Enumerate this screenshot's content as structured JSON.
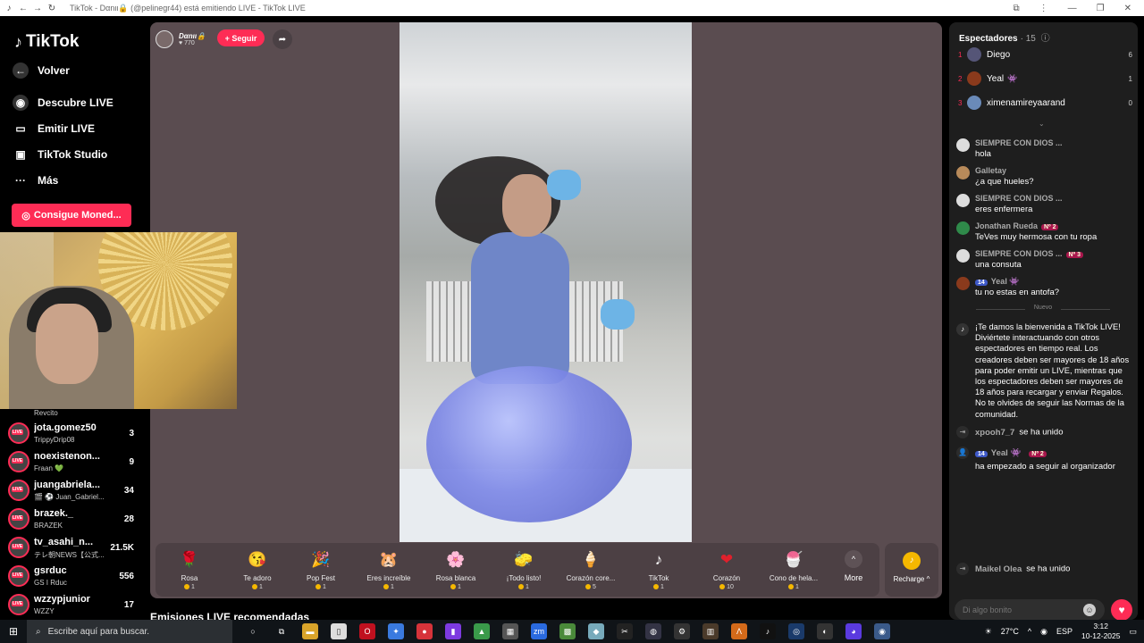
{
  "browser": {
    "tab_title": "TikTok - Dαnιι🔒 (@pelinegr44) está emitiendo LIVE - TikTok LIVE"
  },
  "sidebar": {
    "logo": "TikTok",
    "back": "Volver",
    "nav": [
      {
        "label": "Descubre LIVE",
        "icon": "discover-icon"
      },
      {
        "label": "Emitir LIVE",
        "icon": "camera-icon"
      },
      {
        "label": "TikTok Studio",
        "icon": "studio-icon"
      },
      {
        "label": "Más",
        "icon": "more-icon"
      }
    ],
    "coins_button": "Consigue Moned...",
    "partial_sub": "Revcito",
    "streams": [
      {
        "name": "jota.gomez50",
        "sub": "TrippyDrip08",
        "count": "3"
      },
      {
        "name": "noexistenon...",
        "sub": "Fraan 💚",
        "count": "9"
      },
      {
        "name": "juangabriela...",
        "sub": "🎬 ⚽ Juan_Gabriel...",
        "count": "34"
      },
      {
        "name": "brazek._",
        "sub": "BRAZEK",
        "count": "28"
      },
      {
        "name": "tv_asahi_n...",
        "sub": "テレ朝NEWS【公式...",
        "count": "21.5K"
      },
      {
        "name": "gsrduc",
        "sub": "GS I Rduc",
        "count": "556"
      },
      {
        "name": "wzzypjunior",
        "sub": "WZZY",
        "count": "17"
      }
    ]
  },
  "host": {
    "name": "Dαnιι🔒",
    "likes": "770",
    "follow_label": "+ Seguir"
  },
  "gifts": [
    {
      "icon": "🌹",
      "name": "Rosa",
      "price": "1"
    },
    {
      "icon": "😘",
      "name": "Te adoro",
      "price": "1"
    },
    {
      "icon": "🎉",
      "name": "Pop Fest",
      "price": "1"
    },
    {
      "icon": "🐹",
      "name": "Eres increíble",
      "price": "1"
    },
    {
      "icon": "🌸",
      "name": "Rosa blanca",
      "price": "1"
    },
    {
      "icon": "🧽",
      "name": "¡Todo listo!",
      "price": "1"
    },
    {
      "icon": "🍦",
      "name": "Corazón core...",
      "price": "5"
    },
    {
      "icon": "♪",
      "name": "TikTok",
      "price": "1"
    },
    {
      "icon": "❤",
      "name": "Corazón",
      "price": "10"
    },
    {
      "icon": "🍧",
      "name": "Cono de hela...",
      "price": "1"
    }
  ],
  "more_label": "More",
  "recharge_label": "Recharge ^",
  "recommended_title": "Emisiones LIVE recomendadas",
  "viewers": {
    "title": "Espectadores",
    "count": "· 15",
    "list": [
      {
        "rank": "1",
        "name": "Diego",
        "badge": "",
        "value": "6"
      },
      {
        "rank": "2",
        "name": "Yeal",
        "badge": "👾",
        "value": "1"
      },
      {
        "rank": "3",
        "name": "ximenamireyaarand",
        "badge": "",
        "value": "0"
      }
    ]
  },
  "chat": [
    {
      "name": "SIEMPRE CON DIOS ...",
      "text": "hola",
      "lvl": "",
      "badge": ""
    },
    {
      "name": "Galletay",
      "text": "¿a que hueles?",
      "lvl": "",
      "badge": ""
    },
    {
      "name": "SIEMPRE CON DIOS ...",
      "text": "eres enfermera",
      "lvl": "",
      "badge": ""
    },
    {
      "name": "Jonathan Rueda",
      "text": "TeVes muy hermosa con tu ropa",
      "lvl": "",
      "badge": "Nº 2"
    },
    {
      "name": "SIEMPRE CON DIOS ...",
      "text": "una consuta",
      "lvl": "",
      "badge": "Nº 3"
    },
    {
      "name": "Yeal 👾",
      "text": "tu no estas en antofa?",
      "lvl": "14",
      "badge": ""
    }
  ],
  "nuevo_label": "Nuevo",
  "welcome": "¡Te damos la bienvenida a TikTok LIVE! Diviértete interactuando con otros espectadores en tiempo real. Los creadores deben ser mayores de 18 años para poder emitir un LIVE, mientras que los espectadores deben ser mayores de 18 años para recargar y enviar Regalos. No te olvides de seguir las Normas de la comunidad.",
  "events": [
    {
      "name": "xpooh7_7",
      "text": "se ha unido"
    },
    {
      "name": "Yeal 👾",
      "lvl": "14",
      "badge": "Nº 2",
      "text": "ha empezado a seguir al organizador"
    },
    {
      "name": "Maikel Olea",
      "text": "se ha unido"
    }
  ],
  "chat_placeholder": "Di algo bonito",
  "taskbar": {
    "search_placeholder": "Escribe aquí para buscar.",
    "temperature": "27°C",
    "language": "ESP",
    "time": "3:12",
    "date": "10-12-2025"
  },
  "colors": {
    "accent": "#fe2c55",
    "panel": "#1e1e1e",
    "stage": "#5a4c50"
  }
}
